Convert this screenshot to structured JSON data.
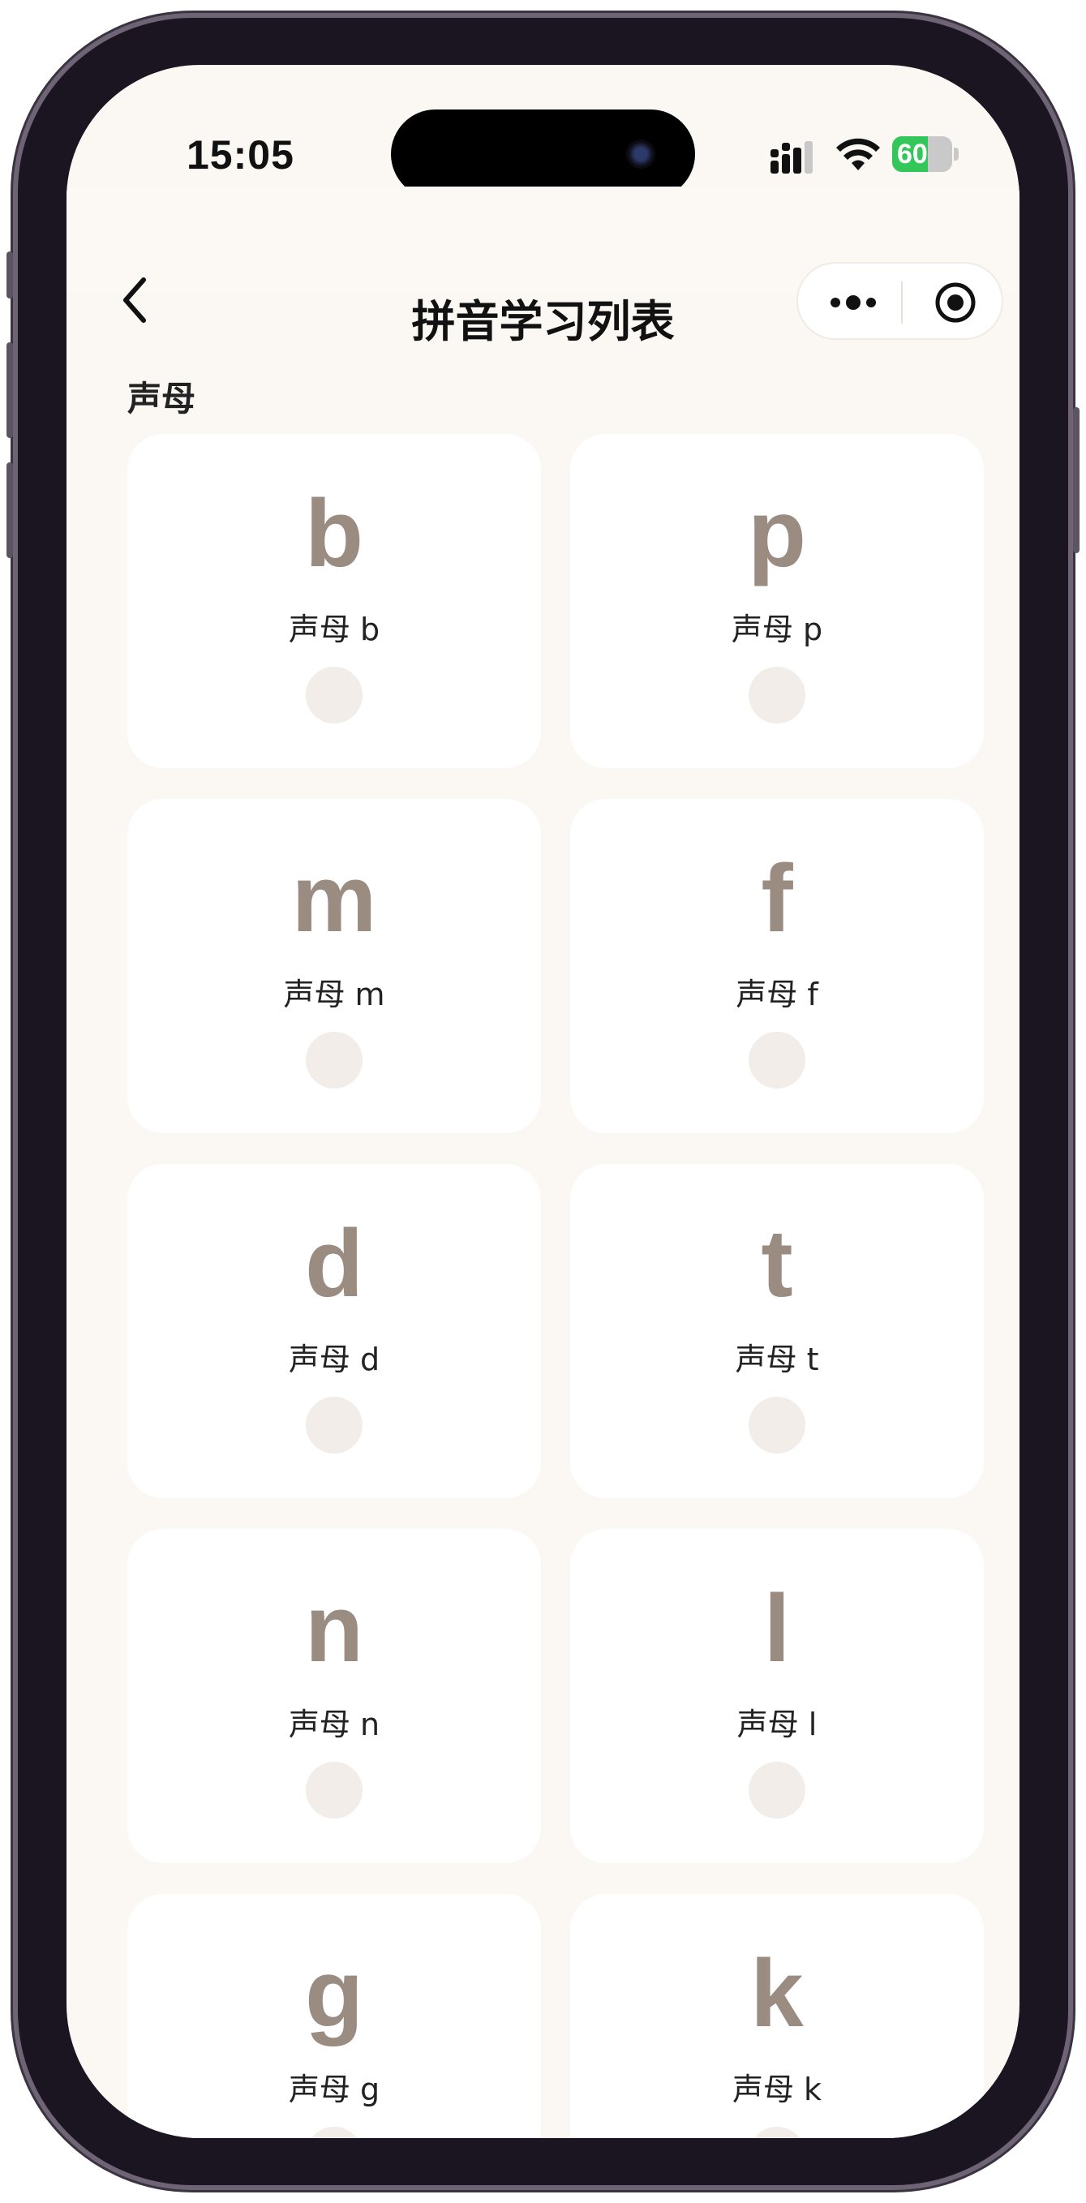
{
  "status_bar": {
    "time": "15:05",
    "battery": "60",
    "battery_level": 0.6
  },
  "navbar": {
    "title": "拼音学习列表"
  },
  "section": {
    "title": "声母"
  },
  "cards": [
    {
      "letter": "b",
      "label": "声母 b"
    },
    {
      "letter": "p",
      "label": "声母 p"
    },
    {
      "letter": "m",
      "label": "声母 m"
    },
    {
      "letter": "f",
      "label": "声母 f"
    },
    {
      "letter": "d",
      "label": "声母 d"
    },
    {
      "letter": "t",
      "label": "声母 t"
    },
    {
      "letter": "n",
      "label": "声母 n"
    },
    {
      "letter": "l",
      "label": "声母 l"
    },
    {
      "letter": "g",
      "label": "声母 g"
    },
    {
      "letter": "k",
      "label": "声母 k"
    }
  ],
  "colors": {
    "background": "#fbf8f4",
    "card": "#ffffff",
    "letter": "#9a8c80",
    "dot": "#f2ede8",
    "battery": "#33c759"
  },
  "icons": {
    "back": "chevron-left-icon",
    "more": "more-dots-icon",
    "close": "target-icon",
    "signal": "cellular-signal-icon",
    "wifi": "wifi-icon",
    "battery": "battery-icon"
  }
}
